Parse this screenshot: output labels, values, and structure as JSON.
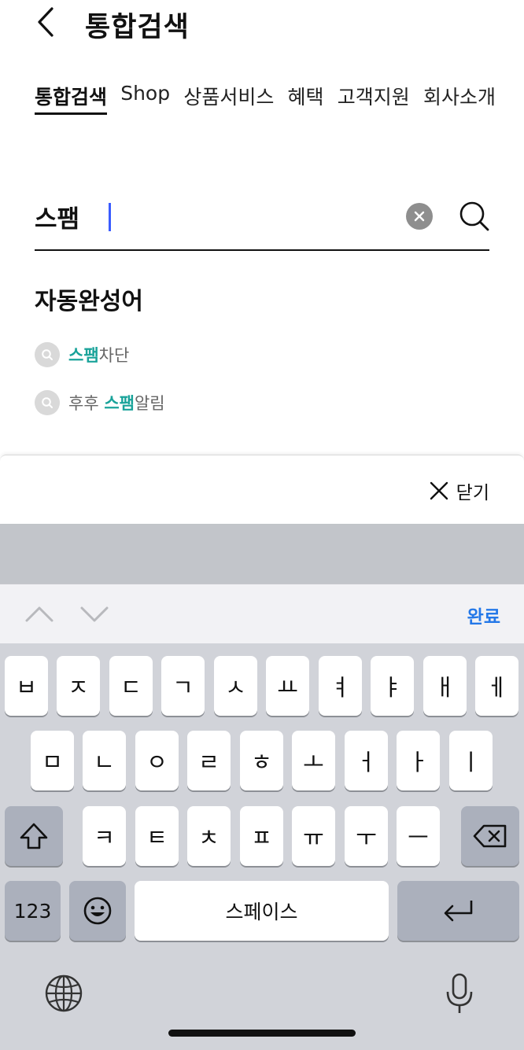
{
  "header": {
    "title": "통합검색",
    "back_icon": "chevron-left-icon"
  },
  "tabs": [
    {
      "label": "통합검색",
      "active": true
    },
    {
      "label": "Shop",
      "active": false
    },
    {
      "label": "상품서비스",
      "active": false
    },
    {
      "label": "혜택",
      "active": false
    },
    {
      "label": "고객지원",
      "active": false
    },
    {
      "label": "회사소개",
      "active": false
    }
  ],
  "search": {
    "value": "스팸",
    "clear_icon": "clear-icon",
    "search_icon": "search-icon"
  },
  "autocomplete": {
    "title": "자동완성어",
    "items": [
      {
        "prefix": "",
        "highlight": "스팸",
        "suffix": "차단"
      },
      {
        "prefix": "후후 ",
        "highlight": "스팸",
        "suffix": "알림"
      }
    ],
    "highlight_color": "#1aa39a"
  },
  "close_bar": {
    "label": "닫기",
    "icon": "close-icon"
  },
  "toolbar": {
    "done_label": "완료",
    "prev_icon": "chevron-up-icon",
    "next_icon": "chevron-down-icon"
  },
  "keyboard": {
    "row1": [
      "ㅂ",
      "ㅈ",
      "ㄷ",
      "ㄱ",
      "ㅅ",
      "ㅛ",
      "ㅕ",
      "ㅑ",
      "ㅐ",
      "ㅔ"
    ],
    "row2": [
      "ㅁ",
      "ㄴ",
      "ㅇ",
      "ㄹ",
      "ㅎ",
      "ㅗ",
      "ㅓ",
      "ㅏ",
      "ㅣ"
    ],
    "row3": [
      "ㅋ",
      "ㅌ",
      "ㅊ",
      "ㅍ",
      "ㅠ",
      "ㅜ",
      "ㅡ"
    ],
    "numbers_label": "123",
    "space_label": "스페이스",
    "shift_icon": "shift-icon",
    "delete_icon": "backspace-icon",
    "emoji_icon": "emoji-icon",
    "return_icon": "return-icon",
    "globe_icon": "globe-icon",
    "mic_icon": "microphone-icon"
  },
  "colors": {
    "accent": "#2478e8",
    "highlight": "#1aa39a",
    "keyboard_bg": "#d1d3d9"
  }
}
